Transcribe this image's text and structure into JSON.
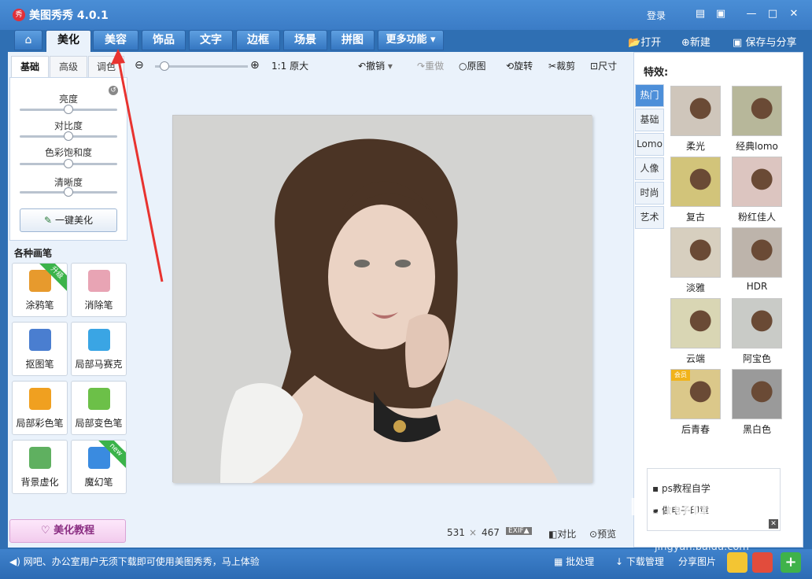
{
  "window": {
    "title": "美图秀秀 4.0.1",
    "logo_glyph": "秀",
    "login": "登录"
  },
  "nav": {
    "tabs": [
      "美化",
      "美容",
      "饰品",
      "文字",
      "边框",
      "场景",
      "拼图",
      "更多功能 ▾"
    ],
    "active_tab": "美化",
    "open": "打开",
    "new": "新建",
    "save": "保存与分享"
  },
  "left_panel": {
    "subtabs": [
      "基础",
      "高级",
      "调色"
    ],
    "sliders": [
      {
        "label": "亮度",
        "value": 0.5
      },
      {
        "label": "对比度",
        "value": 0.5
      },
      {
        "label": "色彩饱和度",
        "value": 0.5
      },
      {
        "label": "清晰度",
        "value": 0.5
      }
    ],
    "one_click": "一键美化",
    "brush_title": "各种画笔",
    "tools": [
      {
        "label": "涂鸦笔",
        "icon": "crayon-icon",
        "ribbon": "升级",
        "color": "#e79a2d"
      },
      {
        "label": "消除笔",
        "icon": "eraser-icon",
        "ribbon": "",
        "color": "#e8a4b4"
      },
      {
        "label": "抠图笔",
        "icon": "pen-cutout-icon",
        "ribbon": "",
        "color": "#4a7ed0"
      },
      {
        "label": "局部马赛克",
        "icon": "mosaic-icon",
        "ribbon": "",
        "color": "#3aa5e4"
      },
      {
        "label": "局部彩色笔",
        "icon": "color-brush-icon",
        "ribbon": "",
        "color": "#f0a020"
      },
      {
        "label": "局部变色笔",
        "icon": "recolor-brush-icon",
        "ribbon": "",
        "color": "#6cc048"
      },
      {
        "label": "背景虚化",
        "icon": "blur-icon",
        "ribbon": "",
        "color": "#5fb060"
      },
      {
        "label": "魔幻笔",
        "icon": "magic-pen-icon",
        "ribbon": "new",
        "color": "#3a8be0"
      }
    ],
    "tutorial": "美化教程"
  },
  "toolbar": {
    "actual_size": "1:1 原大",
    "undo": "撤销",
    "redo": "重做",
    "original": "原图",
    "rotate": "旋转",
    "crop": "裁剪",
    "resize": "尺寸",
    "zoom_level": 0.1
  },
  "canvas": {
    "width_px": "531",
    "times": "×",
    "height_px": "467",
    "exif": "EXIF▲",
    "compare": "对比",
    "preview": "预览"
  },
  "effects": {
    "title": "特效:",
    "categories": [
      "热门",
      "基础",
      "Lomo",
      "人像",
      "时尚",
      "艺术"
    ],
    "active_category": "热门",
    "items": [
      {
        "label": "柔光",
        "tone": "#cfc6bb",
        "badge": ""
      },
      {
        "label": "经典lomo",
        "tone": "#b7b79a",
        "badge": ""
      },
      {
        "label": "复古",
        "tone": "#d2c47a",
        "badge": ""
      },
      {
        "label": "粉红佳人",
        "tone": "#dcc5c0",
        "badge": ""
      },
      {
        "label": "淡雅",
        "tone": "#d7cfbf",
        "badge": ""
      },
      {
        "label": "HDR",
        "tone": "#bdb4ab",
        "badge": ""
      },
      {
        "label": "云端",
        "tone": "#d9d6b4",
        "badge": ""
      },
      {
        "label": "阿宝色",
        "tone": "#c9cbc7",
        "badge": ""
      },
      {
        "label": "后青春",
        "tone": "#dbc88a",
        "badge": "会员"
      },
      {
        "label": "黑白色",
        "tone": "#9a9a9a",
        "badge": ""
      }
    ],
    "ads": [
      "ps教程自学",
      "做电子印章"
    ]
  },
  "statusbar": {
    "message": "网吧、办公室用户无须下载即可使用美图秀秀，马上体验",
    "batch": "批处理",
    "download": "下载管理",
    "share_image": "分享图片"
  },
  "watermark": {
    "brand": "Baidu 经验",
    "url": "jingyan.baidu.com"
  }
}
